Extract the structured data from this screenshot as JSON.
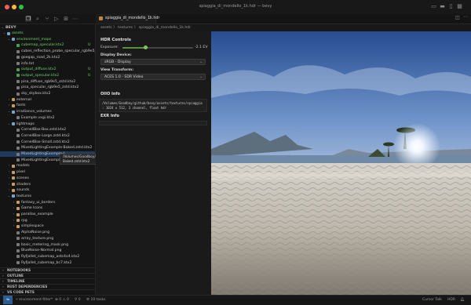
{
  "window": {
    "title": "spiaggia_di_mondello_1k.hdr — bevy",
    "colors": {
      "close": "#ff5f57",
      "minimize": "#febc2e",
      "maximize": "#28c840",
      "accent": "#1f3a5c"
    }
  },
  "sidebar": {
    "project_label": "BEVY",
    "rows": [
      {
        "label": "assets",
        "depth": 0,
        "type": "folder-open",
        "color": "green"
      },
      {
        "label": "environment_maps",
        "depth": 1,
        "type": "folder-open",
        "color": "green"
      },
      {
        "label": "cubemap_specular.ktx2",
        "depth": 2,
        "type": "file",
        "color": "green",
        "badge": "U"
      },
      {
        "label": "cubes_reflection_probe_specular_rgb9e5_...",
        "depth": 2,
        "type": "file",
        "color": "normal"
      },
      {
        "label": "goegap_road_2k.ktx2",
        "depth": 2,
        "type": "file",
        "color": "normal"
      },
      {
        "label": "info.txt",
        "depth": 2,
        "type": "file",
        "color": "normal"
      },
      {
        "label": "output_diffuse.ktx2",
        "depth": 2,
        "type": "file",
        "color": "green",
        "badge": "U"
      },
      {
        "label": "output_specular.ktx2",
        "depth": 2,
        "type": "file",
        "color": "green",
        "badge": "U"
      },
      {
        "label": "pisa_diffuse_rgb9e5_zstd.ktx2",
        "depth": 2,
        "type": "file",
        "color": "normal"
      },
      {
        "label": "pisa_specular_rgb9e5_zstd.ktx2",
        "depth": 2,
        "type": "file",
        "color": "normal"
      },
      {
        "label": "sky_skybox.ktx2",
        "depth": 2,
        "type": "file",
        "color": "normal"
      },
      {
        "label": "external",
        "depth": 1,
        "type": "folder",
        "color": "normal"
      },
      {
        "label": "fonts",
        "depth": 1,
        "type": "folder",
        "color": "normal"
      },
      {
        "label": "irradiance_volumes",
        "depth": 1,
        "type": "folder-open",
        "color": "normal"
      },
      {
        "label": "Example.vxgi.ktx2",
        "depth": 2,
        "type": "file",
        "color": "normal"
      },
      {
        "label": "lightmaps",
        "depth": 1,
        "type": "folder-open",
        "color": "normal"
      },
      {
        "label": "CornellBox-Box.zstd.ktx2",
        "depth": 2,
        "type": "file",
        "color": "normal"
      },
      {
        "label": "CornellBox-Large.zstd.ktx2",
        "depth": 2,
        "type": "file",
        "color": "normal"
      },
      {
        "label": "CornellBox-Small.zstd.ktx2",
        "depth": 2,
        "type": "file",
        "color": "normal"
      },
      {
        "label": "MixedLightingExample-Baked.zstd.ktx2",
        "depth": 2,
        "type": "file",
        "color": "normal"
      },
      {
        "label": "MixedLightingExample-I",
        "depth": 2,
        "type": "file",
        "color": "normal"
      },
      {
        "label": "MixedLightingExample-I",
        "depth": 2,
        "type": "file",
        "color": "normal"
      },
      {
        "label": "models",
        "depth": 1,
        "type": "folder",
        "color": "normal"
      },
      {
        "label": "pixel",
        "depth": 1,
        "type": "folder",
        "color": "normal"
      },
      {
        "label": "scenes",
        "depth": 1,
        "type": "folder",
        "color": "normal"
      },
      {
        "label": "shaders",
        "depth": 1,
        "type": "folder",
        "color": "normal"
      },
      {
        "label": "sounds",
        "depth": 1,
        "type": "folder",
        "color": "normal"
      },
      {
        "label": "textures",
        "depth": 1,
        "type": "folder-open",
        "color": "normal"
      },
      {
        "label": "fantasy_ui_borders",
        "depth": 2,
        "type": "folder",
        "color": "normal"
      },
      {
        "label": "Game Icons",
        "depth": 2,
        "type": "folder",
        "color": "normal"
      },
      {
        "label": "parallax_example",
        "depth": 2,
        "type": "folder",
        "color": "normal"
      },
      {
        "label": "rpg",
        "depth": 2,
        "type": "folder",
        "color": "normal"
      },
      {
        "label": "simplespace",
        "depth": 2,
        "type": "folder",
        "color": "normal"
      },
      {
        "label": "AlphaNoise.png",
        "depth": 2,
        "type": "file",
        "color": "normal"
      },
      {
        "label": "array_texture.png",
        "depth": 2,
        "type": "file",
        "color": "normal"
      },
      {
        "label": "basic_metering_mask.png",
        "depth": 2,
        "type": "file",
        "color": "normal"
      },
      {
        "label": "BlueNoise-Normal.png",
        "depth": 2,
        "type": "file",
        "color": "normal"
      },
      {
        "label": "Ryfjallet_cubemap_astc4x4.ktx2",
        "depth": 2,
        "type": "file",
        "color": "normal"
      },
      {
        "label": "Ryfjallet_cubemap_bc7.ktx2",
        "depth": 2,
        "type": "file",
        "color": "normal"
      }
    ],
    "panels": [
      "NOTEBOOKS",
      "OUTLINE",
      "TIMELINE",
      "RUST DEPENDENCIES",
      "VS CODE PETS"
    ]
  },
  "tooltip": {
    "line1": "/Volumes/Goodboy/github/bevy/assets/lightmaps/MixedLightingExample-",
    "line2": "Baked.zstd.ktx2"
  },
  "editor": {
    "tab_label": "spiaggia_di_mondello_1k.hdr",
    "breadcrumb": "assets  〉 textures  〉 spiaggia_di_mondello_1k.hdr"
  },
  "controls": {
    "heading": "HDR Controls",
    "exposure_label": "Exposure:",
    "exposure_value": "-2.1 EV",
    "exposure_fraction": 0.33,
    "display_device_label": "Display Device:",
    "display_device_value": "sRGB - Display",
    "view_transform_label": "View Transform:",
    "view_transform_value": "ACES 1.0 - SDR Video",
    "oiio_heading": "OIIO Info",
    "oiio_line1": "/Volumes/Goodboy/github/bevy/assets/textures/spiaggia",
    "oiio_line2": ": 1024 x  512, 3 channel, float hdr",
    "exr_heading": "EXR Info"
  },
  "statusbar": {
    "branch": "environment-filter*",
    "problems": "⊗ 0 ⚠ 0",
    "ports": "⚲ 0",
    "tasks": "⚙ 10 tasks",
    "position": "Cursor Talk",
    "zoom": "HDR"
  }
}
